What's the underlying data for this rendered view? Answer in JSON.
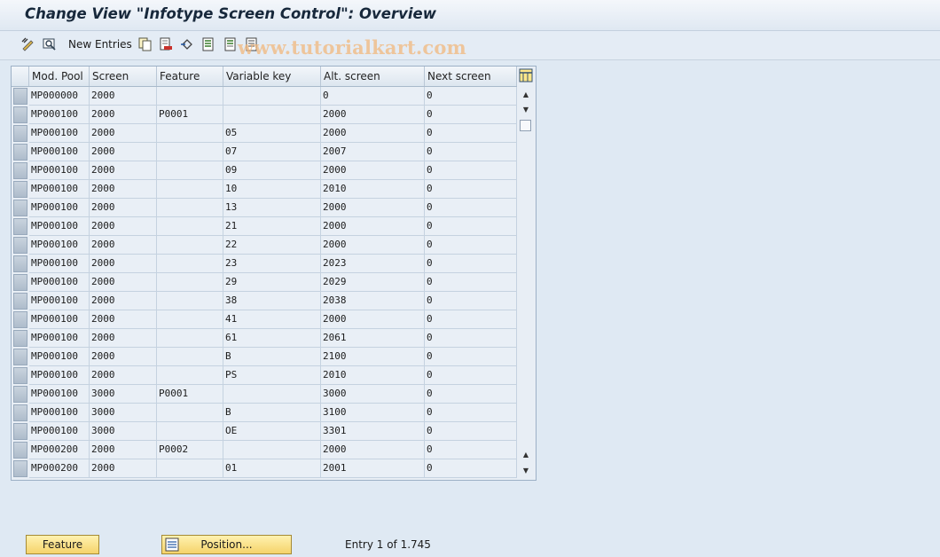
{
  "title": "Change View \"Infotype Screen Control\": Overview",
  "watermark": "www.tutorialkart.com",
  "toolbar": {
    "new_entries_label": "New Entries",
    "icons": [
      "edit-toggle-icon",
      "display-icon",
      "copy-icon",
      "delete-icon",
      "undo-icon",
      "select-all-icon",
      "select-block-icon",
      "deselect-all-icon"
    ]
  },
  "table": {
    "headers": [
      "Mod. Pool",
      "Screen",
      "Feature",
      "Variable key",
      "Alt. screen",
      "Next screen"
    ],
    "rows": [
      [
        "MP000000",
        "2000",
        "",
        "",
        "0",
        "0"
      ],
      [
        "MP000100",
        "2000",
        "P0001",
        "",
        "2000",
        "0"
      ],
      [
        "MP000100",
        "2000",
        "",
        "05",
        "2000",
        "0"
      ],
      [
        "MP000100",
        "2000",
        "",
        "07",
        "2007",
        "0"
      ],
      [
        "MP000100",
        "2000",
        "",
        "09",
        "2000",
        "0"
      ],
      [
        "MP000100",
        "2000",
        "",
        "10",
        "2010",
        "0"
      ],
      [
        "MP000100",
        "2000",
        "",
        "13",
        "2000",
        "0"
      ],
      [
        "MP000100",
        "2000",
        "",
        "21",
        "2000",
        "0"
      ],
      [
        "MP000100",
        "2000",
        "",
        "22",
        "2000",
        "0"
      ],
      [
        "MP000100",
        "2000",
        "",
        "23",
        "2023",
        "0"
      ],
      [
        "MP000100",
        "2000",
        "",
        "29",
        "2029",
        "0"
      ],
      [
        "MP000100",
        "2000",
        "",
        "38",
        "2038",
        "0"
      ],
      [
        "MP000100",
        "2000",
        "",
        "41",
        "2000",
        "0"
      ],
      [
        "MP000100",
        "2000",
        "",
        "61",
        "2061",
        "0"
      ],
      [
        "MP000100",
        "2000",
        "",
        "B",
        "2100",
        "0"
      ],
      [
        "MP000100",
        "2000",
        "",
        "PS",
        "2010",
        "0"
      ],
      [
        "MP000100",
        "3000",
        "P0001",
        "",
        "3000",
        "0"
      ],
      [
        "MP000100",
        "3000",
        "",
        "B",
        "3100",
        "0"
      ],
      [
        "MP000100",
        "3000",
        "",
        "OE",
        "3301",
        "0"
      ],
      [
        "MP000200",
        "2000",
        "P0002",
        "",
        "2000",
        "0"
      ],
      [
        "MP000200",
        "2000",
        "",
        "01",
        "2001",
        "0"
      ]
    ]
  },
  "buttons": {
    "feature_label": "Feature",
    "position_label": "Position..."
  },
  "status": {
    "entry_text": "Entry 1 of 1.745"
  }
}
